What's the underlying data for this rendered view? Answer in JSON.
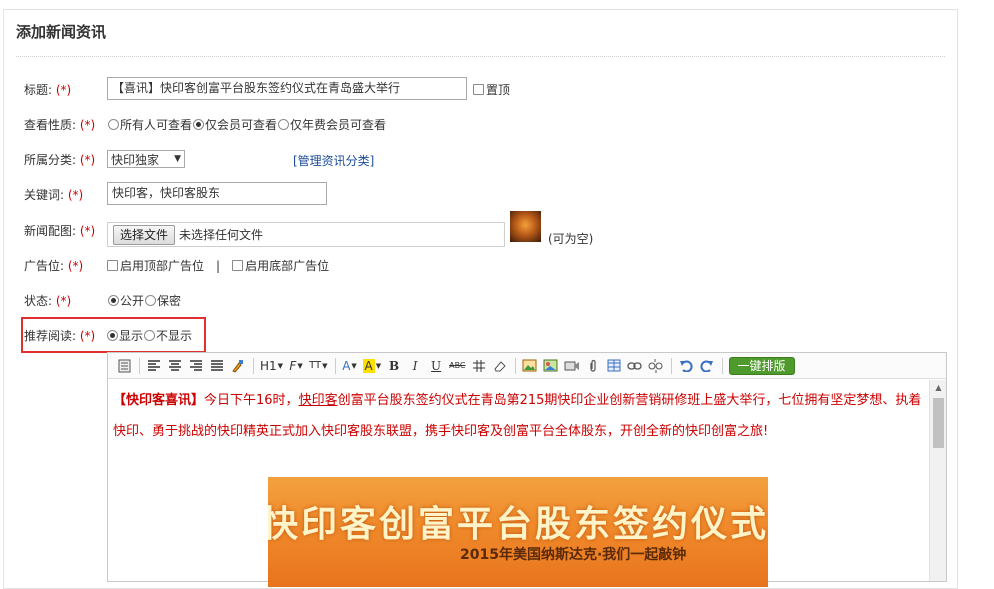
{
  "panel": {
    "title": "添加新闻资讯"
  },
  "required_mark": "(*)",
  "form": {
    "title": {
      "label": "标题:",
      "value": "【喜讯】快印客创富平台股东签约仪式在青岛盛大举行",
      "pin_label": "置顶",
      "pin_checked": false
    },
    "visibility": {
      "label": "查看性质:",
      "options": [
        "所有人可查看",
        "仅会员可查看",
        "仅年费会员可查看"
      ],
      "selected": "仅会员可查看"
    },
    "category": {
      "label": "所属分类:",
      "value": "快印独家",
      "manage_link": "[管理资讯分类]"
    },
    "keywords": {
      "label": "关键词:",
      "value": "快印客，快印客股东"
    },
    "image": {
      "label": "新闻配图:",
      "button_label": "选择文件",
      "status": "未选择任何文件",
      "hint": "(可为空)"
    },
    "ads": {
      "label": "广告位:",
      "top_label": "启用顶部广告位",
      "divider": "|",
      "bottom_label": "启用底部广告位"
    },
    "status": {
      "label": "状态:",
      "options": [
        "公开",
        "保密"
      ],
      "selected": "公开"
    },
    "recommend": {
      "label": "推荐阅读:",
      "options": [
        "显示",
        "不显示"
      ],
      "selected": "显示"
    }
  },
  "editor": {
    "toolbar": {
      "h1": "H1",
      "font_family": "F",
      "font_size": "TT",
      "font_color": "A",
      "highlight": "A",
      "bold": "B",
      "italic": "I",
      "underline": "U",
      "strike": "ABC",
      "one_click_label": "一键排版"
    },
    "content": {
      "lead": "【快印客喜讯】",
      "text1": "今日下午16时，",
      "link": "快印客",
      "text2": "创富平台股东签约仪式在青岛第215期快印企业创新营销研修班上盛大举行，七位拥有坚定梦想、执着快印、勇于挑战的快印精英正式加入快印客股东联盟，携手快印客及创富平台全体股东，开创全新的快印创富之旅!"
    },
    "banner": {
      "title": "快印客创富平台股东签约仪式",
      "subtitle": "2015年美国纳斯达克·我们一起敲钟"
    }
  }
}
